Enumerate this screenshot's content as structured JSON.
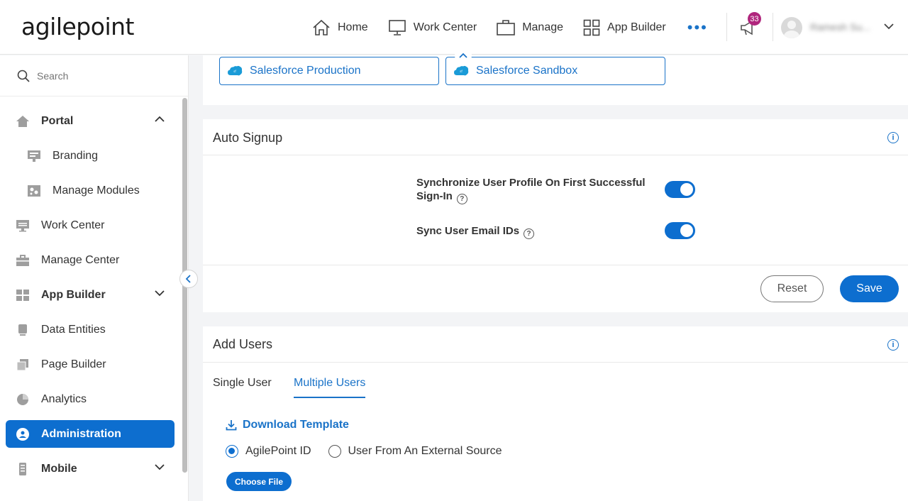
{
  "header": {
    "logo_text": "agilepoint",
    "nav": [
      {
        "label": "Home",
        "icon": "home-icon"
      },
      {
        "label": "Work Center",
        "icon": "monitor-icon"
      },
      {
        "label": "Manage",
        "icon": "briefcase-icon"
      },
      {
        "label": "App Builder",
        "icon": "grid-icon"
      }
    ],
    "more_label": "•••",
    "notification_count": "33",
    "user_name": "Ramesh Su..."
  },
  "sidebar": {
    "search_placeholder": "Search",
    "items": [
      {
        "label": "Portal",
        "icon": "home-icon",
        "expandable": true,
        "expanded": true
      },
      {
        "label": "Branding",
        "icon": "branding-icon",
        "sub": true
      },
      {
        "label": "Manage Modules",
        "icon": "modules-icon",
        "sub": true
      },
      {
        "label": "Work Center",
        "icon": "monitor-icon"
      },
      {
        "label": "Manage Center",
        "icon": "briefcase-icon"
      },
      {
        "label": "App Builder",
        "icon": "grid-icon",
        "expandable": true
      },
      {
        "label": "Data Entities",
        "icon": "database-icon"
      },
      {
        "label": "Page Builder",
        "icon": "pages-icon"
      },
      {
        "label": "Analytics",
        "icon": "pie-chart-icon"
      },
      {
        "label": "Administration",
        "icon": "admin-icon",
        "active": true
      },
      {
        "label": "Mobile",
        "icon": "mobile-icon",
        "expandable": true
      }
    ]
  },
  "providers": {
    "items": [
      "Salesforce Production",
      "Salesforce Sandbox"
    ]
  },
  "auto_signup": {
    "title": "Auto Signup",
    "options": [
      {
        "label_line1": "Synchronize User Profile On First Successful",
        "label_line2": "Sign-In",
        "enabled": true
      },
      {
        "label_line1": "Sync User Email IDs",
        "enabled": true
      }
    ],
    "reset_label": "Reset",
    "save_label": "Save"
  },
  "add_users": {
    "title": "Add Users",
    "tabs": [
      "Single User",
      "Multiple Users"
    ],
    "active_tab": "Multiple Users",
    "download_label": "Download Template",
    "sources": [
      "AgilePoint ID",
      "User From An External Source"
    ],
    "selected_source": "AgilePoint ID",
    "choose_file_label": "Choose File"
  },
  "colors": {
    "accent": "#0d6ecf",
    "badge": "#b0267d"
  }
}
